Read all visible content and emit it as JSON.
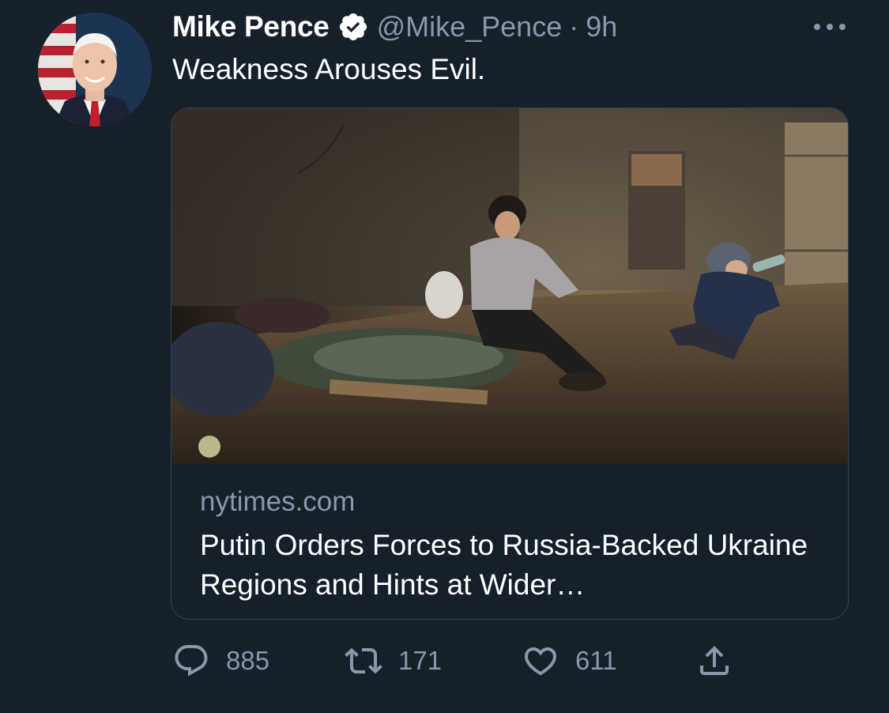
{
  "tweet": {
    "author_name": "Mike Pence",
    "handle": "@Mike_Pence",
    "separator": "·",
    "time": "9h",
    "text": "Weakness Arouses Evil.",
    "avatar_icon": "profile-photo",
    "verified_icon": "verified-badge-icon",
    "more_icon": "more-options-icon"
  },
  "card": {
    "domain": "nytimes.com",
    "title": "Putin Orders Forces to Russia-Backed Ukraine Regions and Hints at Wider…",
    "image_icon": "article-photo"
  },
  "actions": {
    "reply_count": "885",
    "retweet_count": "171",
    "like_count": "611",
    "reply_icon": "reply-icon",
    "retweet_icon": "retweet-icon",
    "like_icon": "heart-icon",
    "share_icon": "share-icon"
  },
  "colors": {
    "background": "#15202b",
    "secondary_text": "#8b98a5",
    "border": "#38444d",
    "primary_text": "#ffffff"
  }
}
